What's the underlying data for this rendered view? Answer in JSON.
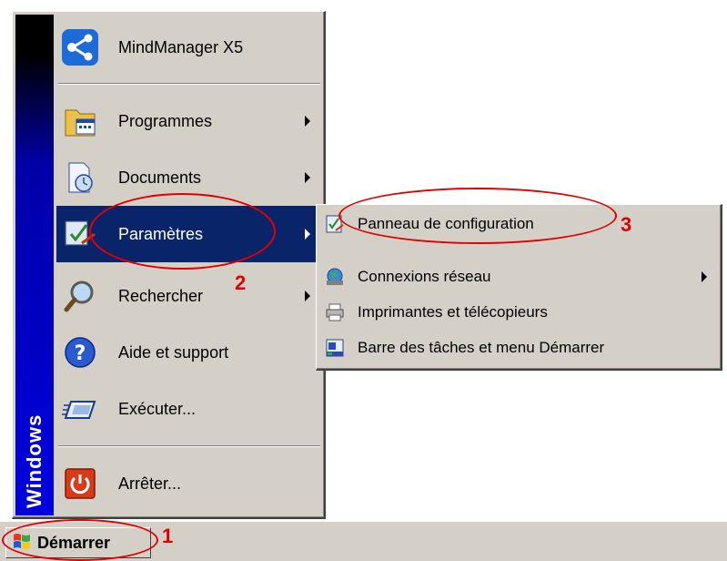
{
  "start_menu": {
    "brand": "Windows",
    "items": [
      {
        "label": "MindManager X5",
        "icon": "mindmanager-icon",
        "has_submenu": false
      },
      {
        "label": "Programmes",
        "icon": "programs-icon",
        "has_submenu": true
      },
      {
        "label": "Documents",
        "icon": "documents-icon",
        "has_submenu": true
      },
      {
        "label": "Paramètres",
        "icon": "settings-icon",
        "has_submenu": true,
        "selected": true
      },
      {
        "label": "Rechercher",
        "icon": "search-icon",
        "has_submenu": true
      },
      {
        "label": "Aide et support",
        "icon": "help-icon",
        "has_submenu": false
      },
      {
        "label": "Exécuter...",
        "icon": "run-icon",
        "has_submenu": false
      },
      {
        "label": "Arrêter...",
        "icon": "shutdown-icon",
        "has_submenu": false
      }
    ]
  },
  "submenu": {
    "items": [
      {
        "label": "Panneau de configuration",
        "icon": "control-panel-icon",
        "has_submenu": false
      },
      {
        "label": "Connexions réseau",
        "icon": "network-icon",
        "has_submenu": true
      },
      {
        "label": "Imprimantes et télécopieurs",
        "icon": "printer-icon",
        "has_submenu": false
      },
      {
        "label": "Barre des tâches et menu Démarrer",
        "icon": "taskbar-icon",
        "has_submenu": false
      }
    ]
  },
  "taskbar": {
    "start_label": "Démarrer"
  },
  "annotations": {
    "step1": "1",
    "step2": "2",
    "step3": "3",
    "color": "#e00000"
  },
  "colors": {
    "menu_bg": "#d4d0c8",
    "highlight": "#0a246a",
    "banner": "#0000e0"
  }
}
